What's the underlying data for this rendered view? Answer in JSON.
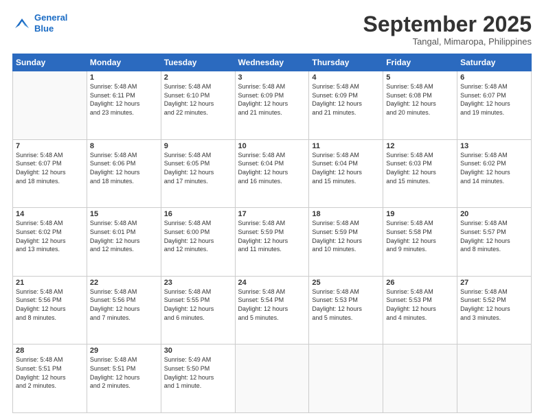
{
  "logo": {
    "line1": "General",
    "line2": "Blue"
  },
  "title": "September 2025",
  "location": "Tangal, Mimaropa, Philippines",
  "days_of_week": [
    "Sunday",
    "Monday",
    "Tuesday",
    "Wednesday",
    "Thursday",
    "Friday",
    "Saturday"
  ],
  "weeks": [
    [
      {
        "day": "",
        "info": ""
      },
      {
        "day": "1",
        "info": "Sunrise: 5:48 AM\nSunset: 6:11 PM\nDaylight: 12 hours\nand 23 minutes."
      },
      {
        "day": "2",
        "info": "Sunrise: 5:48 AM\nSunset: 6:10 PM\nDaylight: 12 hours\nand 22 minutes."
      },
      {
        "day": "3",
        "info": "Sunrise: 5:48 AM\nSunset: 6:09 PM\nDaylight: 12 hours\nand 21 minutes."
      },
      {
        "day": "4",
        "info": "Sunrise: 5:48 AM\nSunset: 6:09 PM\nDaylight: 12 hours\nand 21 minutes."
      },
      {
        "day": "5",
        "info": "Sunrise: 5:48 AM\nSunset: 6:08 PM\nDaylight: 12 hours\nand 20 minutes."
      },
      {
        "day": "6",
        "info": "Sunrise: 5:48 AM\nSunset: 6:07 PM\nDaylight: 12 hours\nand 19 minutes."
      }
    ],
    [
      {
        "day": "7",
        "info": "Sunrise: 5:48 AM\nSunset: 6:07 PM\nDaylight: 12 hours\nand 18 minutes."
      },
      {
        "day": "8",
        "info": "Sunrise: 5:48 AM\nSunset: 6:06 PM\nDaylight: 12 hours\nand 18 minutes."
      },
      {
        "day": "9",
        "info": "Sunrise: 5:48 AM\nSunset: 6:05 PM\nDaylight: 12 hours\nand 17 minutes."
      },
      {
        "day": "10",
        "info": "Sunrise: 5:48 AM\nSunset: 6:04 PM\nDaylight: 12 hours\nand 16 minutes."
      },
      {
        "day": "11",
        "info": "Sunrise: 5:48 AM\nSunset: 6:04 PM\nDaylight: 12 hours\nand 15 minutes."
      },
      {
        "day": "12",
        "info": "Sunrise: 5:48 AM\nSunset: 6:03 PM\nDaylight: 12 hours\nand 15 minutes."
      },
      {
        "day": "13",
        "info": "Sunrise: 5:48 AM\nSunset: 6:02 PM\nDaylight: 12 hours\nand 14 minutes."
      }
    ],
    [
      {
        "day": "14",
        "info": "Sunrise: 5:48 AM\nSunset: 6:02 PM\nDaylight: 12 hours\nand 13 minutes."
      },
      {
        "day": "15",
        "info": "Sunrise: 5:48 AM\nSunset: 6:01 PM\nDaylight: 12 hours\nand 12 minutes."
      },
      {
        "day": "16",
        "info": "Sunrise: 5:48 AM\nSunset: 6:00 PM\nDaylight: 12 hours\nand 12 minutes."
      },
      {
        "day": "17",
        "info": "Sunrise: 5:48 AM\nSunset: 5:59 PM\nDaylight: 12 hours\nand 11 minutes."
      },
      {
        "day": "18",
        "info": "Sunrise: 5:48 AM\nSunset: 5:59 PM\nDaylight: 12 hours\nand 10 minutes."
      },
      {
        "day": "19",
        "info": "Sunrise: 5:48 AM\nSunset: 5:58 PM\nDaylight: 12 hours\nand 9 minutes."
      },
      {
        "day": "20",
        "info": "Sunrise: 5:48 AM\nSunset: 5:57 PM\nDaylight: 12 hours\nand 8 minutes."
      }
    ],
    [
      {
        "day": "21",
        "info": "Sunrise: 5:48 AM\nSunset: 5:56 PM\nDaylight: 12 hours\nand 8 minutes."
      },
      {
        "day": "22",
        "info": "Sunrise: 5:48 AM\nSunset: 5:56 PM\nDaylight: 12 hours\nand 7 minutes."
      },
      {
        "day": "23",
        "info": "Sunrise: 5:48 AM\nSunset: 5:55 PM\nDaylight: 12 hours\nand 6 minutes."
      },
      {
        "day": "24",
        "info": "Sunrise: 5:48 AM\nSunset: 5:54 PM\nDaylight: 12 hours\nand 5 minutes."
      },
      {
        "day": "25",
        "info": "Sunrise: 5:48 AM\nSunset: 5:53 PM\nDaylight: 12 hours\nand 5 minutes."
      },
      {
        "day": "26",
        "info": "Sunrise: 5:48 AM\nSunset: 5:53 PM\nDaylight: 12 hours\nand 4 minutes."
      },
      {
        "day": "27",
        "info": "Sunrise: 5:48 AM\nSunset: 5:52 PM\nDaylight: 12 hours\nand 3 minutes."
      }
    ],
    [
      {
        "day": "28",
        "info": "Sunrise: 5:48 AM\nSunset: 5:51 PM\nDaylight: 12 hours\nand 2 minutes."
      },
      {
        "day": "29",
        "info": "Sunrise: 5:48 AM\nSunset: 5:51 PM\nDaylight: 12 hours\nand 2 minutes."
      },
      {
        "day": "30",
        "info": "Sunrise: 5:49 AM\nSunset: 5:50 PM\nDaylight: 12 hours\nand 1 minute."
      },
      {
        "day": "",
        "info": ""
      },
      {
        "day": "",
        "info": ""
      },
      {
        "day": "",
        "info": ""
      },
      {
        "day": "",
        "info": ""
      }
    ]
  ]
}
